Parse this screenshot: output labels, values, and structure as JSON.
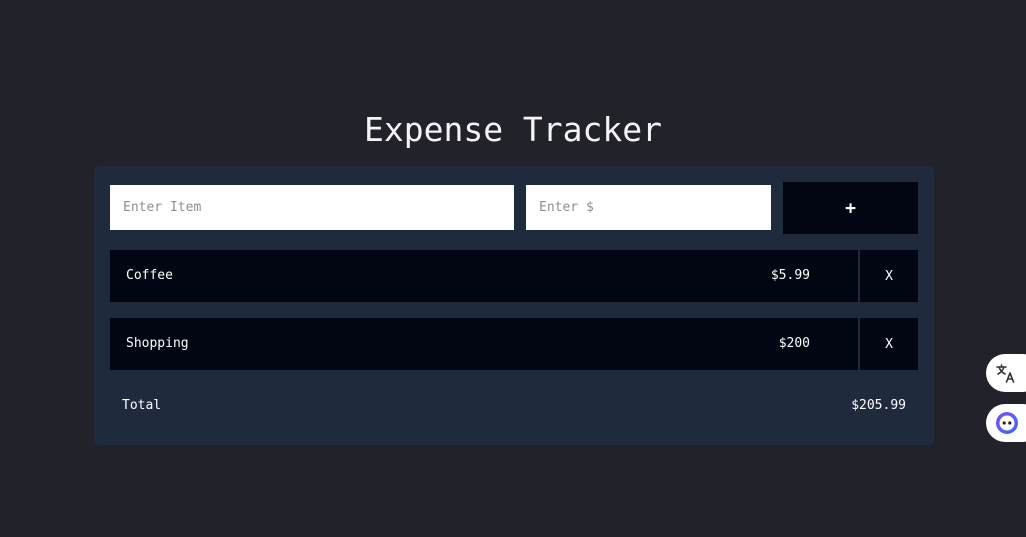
{
  "header": {
    "title": "Expense Tracker"
  },
  "form": {
    "item_placeholder": "Enter Item",
    "amount_placeholder": "Enter $",
    "add_label": "+"
  },
  "expenses": [
    {
      "name": "Coffee",
      "amount": "$5.99",
      "delete_label": "X"
    },
    {
      "name": "Shopping",
      "amount": "$200",
      "delete_label": "X"
    }
  ],
  "summary": {
    "total_label": "Total",
    "total_value": "$205.99"
  },
  "side_tools": {
    "translate_icon": "translate-icon",
    "assistant_icon": "assistant-icon"
  },
  "colors": {
    "background": "#22222a",
    "card": "#1f2a3c",
    "row": "#020612"
  }
}
